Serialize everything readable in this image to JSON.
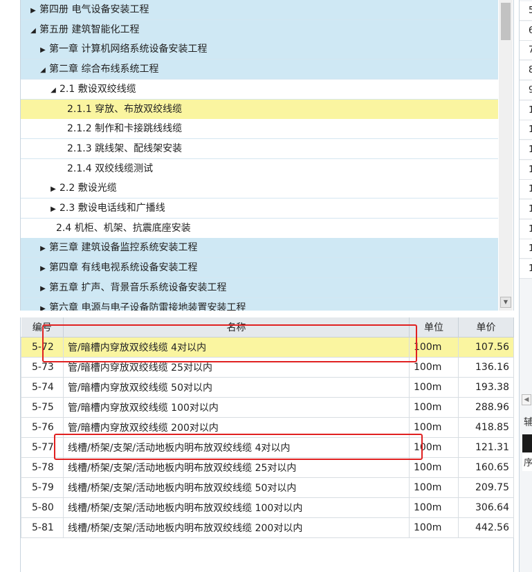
{
  "tree": {
    "rows": [
      {
        "text": "第四册 电气设备安装工程",
        "arrow": "▶",
        "style": "blue"
      },
      {
        "text": "第五册 建筑智能化工程",
        "arrow": "◢",
        "style": "blue"
      },
      {
        "text": "第一章 计算机网络系统设备安装工程",
        "arrow": "▶",
        "style": "blue"
      },
      {
        "text": "第二章 综合布线系统工程",
        "arrow": "◢",
        "style": "blue"
      },
      {
        "text": "2.1 敷设双绞线缆",
        "arrow": "◢",
        "style": "white"
      },
      {
        "text": "2.1.1 穿放、布放双绞线缆",
        "arrow": "",
        "style": "yellow"
      },
      {
        "text": "2.1.2 制作和卡接跳线线缆",
        "arrow": "",
        "style": "white"
      },
      {
        "text": "2.1.3 跳线架、配线架安装",
        "arrow": "",
        "style": "white"
      },
      {
        "text": "2.1.4 双绞线缆测试",
        "arrow": "",
        "style": "white"
      },
      {
        "text": "2.2 敷设光缆",
        "arrow": "▶",
        "style": "white"
      },
      {
        "text": "2.3 敷设电话线和广播线",
        "arrow": "▶",
        "style": "white"
      },
      {
        "text": "2.4 机柜、机架、抗震底座安装",
        "arrow": "",
        "style": "white"
      },
      {
        "text": "第三章 建筑设备监控系统安装工程",
        "arrow": "▶",
        "style": "blue"
      },
      {
        "text": "第四章 有线电视系统设备安装工程",
        "arrow": "▶",
        "style": "blue"
      },
      {
        "text": "第五章 扩声、背景音乐系统设备安装工程",
        "arrow": "▶",
        "style": "blue"
      },
      {
        "text": "第六章 电源与电子设备防雷接地装置安装工程",
        "arrow": "▶",
        "style": "blue"
      }
    ],
    "scroll_down_icon": "▼"
  },
  "table": {
    "headers": {
      "code": "编号",
      "name": "名称",
      "unit": "单位",
      "price": "单价"
    },
    "rows": [
      {
        "code": "5-72",
        "name": "管/暗槽内穿放双绞线缆 4对以内",
        "unit": "100m",
        "price": "107.56"
      },
      {
        "code": "5-73",
        "name": "管/暗槽内穿放双绞线缆 25对以内",
        "unit": "100m",
        "price": "136.16"
      },
      {
        "code": "5-74",
        "name": "管/暗槽内穿放双绞线缆 50对以内",
        "unit": "100m",
        "price": "193.38"
      },
      {
        "code": "5-75",
        "name": "管/暗槽内穿放双绞线缆 100对以内",
        "unit": "100m",
        "price": "288.96"
      },
      {
        "code": "5-76",
        "name": "管/暗槽内穿放双绞线缆 200对以内",
        "unit": "100m",
        "price": "418.85"
      },
      {
        "code": "5-77",
        "name": "线槽/桥架/支架/活动地板内明布放双绞线缆 4对以内",
        "unit": "100m",
        "price": "121.31"
      },
      {
        "code": "5-78",
        "name": "线槽/桥架/支架/活动地板内明布放双绞线缆 25对以内",
        "unit": "100m",
        "price": "160.65"
      },
      {
        "code": "5-79",
        "name": "线槽/桥架/支架/活动地板内明布放双绞线缆 50对以内",
        "unit": "100m",
        "price": "209.75"
      },
      {
        "code": "5-80",
        "name": "线槽/桥架/支架/活动地板内明布放双绞线缆 100对以内",
        "unit": "100m",
        "price": "306.64"
      },
      {
        "code": "5-81",
        "name": "线槽/桥架/支架/活动地板内明布放双绞线缆 200对以内",
        "unit": "100m",
        "price": "442.56"
      }
    ]
  },
  "right_panel": {
    "rows": [
      "5",
      "6",
      "7",
      "8",
      "9",
      "1",
      "1",
      "1",
      "1",
      "1",
      "1",
      "1",
      "1",
      "1"
    ],
    "scroll_left_icon": "◀",
    "tab_label": "辅",
    "label": "序"
  },
  "colors": {
    "blue_row": "#cfe8f4",
    "selected_row": "#faf5a0",
    "highlight_box": "#e02020"
  }
}
